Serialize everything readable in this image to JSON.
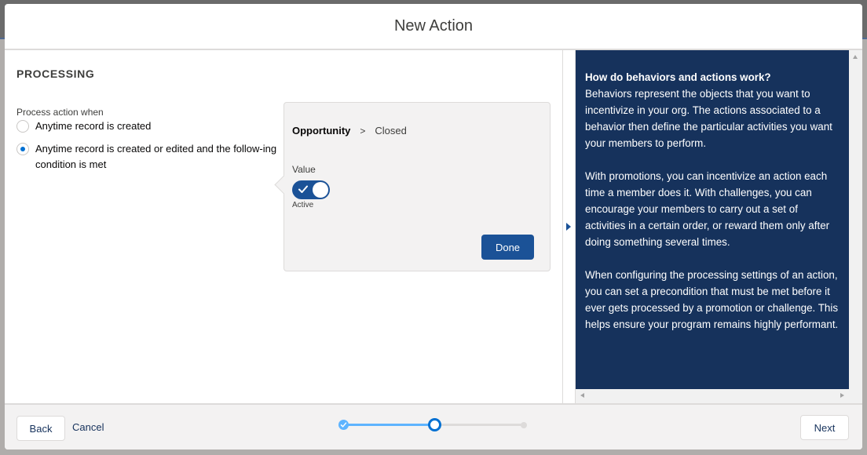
{
  "modal": {
    "title": "New Action"
  },
  "processing": {
    "section_title": "PROCESSING",
    "legend": "Process action when",
    "options": [
      {
        "label": "Anytime record is created",
        "selected": false
      },
      {
        "label": "Anytime record is created or edited and the follow-ing condition is met",
        "selected": true
      }
    ]
  },
  "condition": {
    "object": "Opportunity",
    "separator": ">",
    "field": "Closed",
    "value_label": "Value",
    "toggle_state": "Active",
    "toggle_on": true,
    "done_label": "Done"
  },
  "help": {
    "heading": "How do behaviors and actions work?",
    "paragraphs": [
      "Behaviors represent the objects that you want to incentivize in your org. The actions associated to a behavior then define the particular activities you want your members to perform.",
      "With promotions, you can incentivize an action each time a member does it. With challenges, you can encourage your members to carry out a set of activities in a certain order, or reward them only after doing something several times.",
      "When configuring the processing settings of an action, you can set a precondition that must be met before it ever gets processed by a promotion or challenge. This helps ensure your program remains highly performant."
    ]
  },
  "footer": {
    "back_label": "Back",
    "cancel_label": "Cancel",
    "next_label": "Next",
    "progress": {
      "total_steps": 3,
      "current_step": 2
    }
  },
  "colors": {
    "brand": "#1b5297",
    "help_bg": "#16325c",
    "progress_active": "#0070d2",
    "progress_done": "#5eb4ff"
  }
}
